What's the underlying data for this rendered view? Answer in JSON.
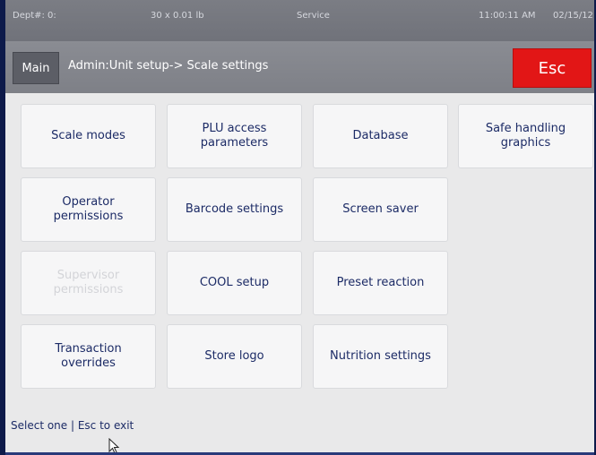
{
  "status_bar": {
    "dept": "Dept#: 0:",
    "weight": "30 x 0.01 lb",
    "mode": "Service",
    "time": "11:00:11 AM",
    "date": "02/15/12"
  },
  "title_bar": {
    "main_label": "Main",
    "breadcrumb": "Admin:Unit setup-> Scale settings",
    "esc_label": "Esc"
  },
  "tiles": {
    "scale_modes": "Scale modes",
    "plu_access": "PLU access parameters",
    "database": "Database",
    "safe_handling": "Safe handling graphics",
    "operator_permissions": "Operator permissions",
    "barcode_settings": "Barcode settings",
    "screen_saver": "Screen saver",
    "supervisor_permissions": "Supervisor permissions",
    "cool_setup": "COOL setup",
    "preset_reaction": "Preset reaction",
    "transaction_overrides": "Transaction overrides",
    "store_logo": "Store logo",
    "nutrition_settings": "Nutrition settings"
  },
  "footer": {
    "hint": "Select one | Esc to exit"
  },
  "colors": {
    "esc": "#e21616",
    "tile_text": "#1c2b66",
    "disabled_text": "#d3d4d8"
  },
  "icons": {
    "cursor": "mouse-pointer-icon"
  }
}
